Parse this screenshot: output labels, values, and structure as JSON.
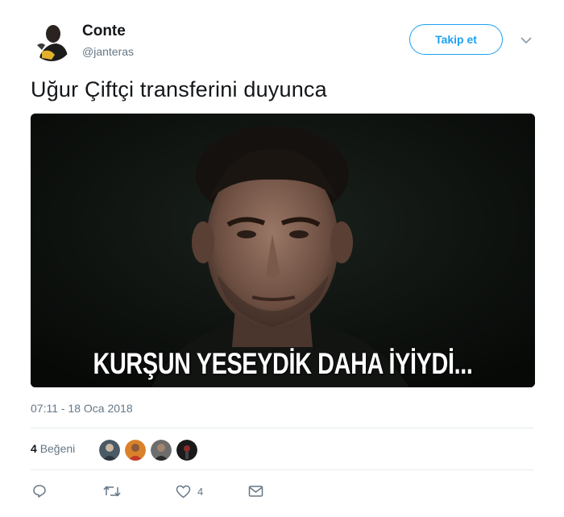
{
  "user": {
    "display_name": "Conte",
    "handle": "@janteras",
    "follow_label": "Takip et",
    "avatar_icon": "user-avatar-icon"
  },
  "tweet": {
    "text": "Uğur Çiftçi transferini duyunca",
    "media_caption": "KURŞUN YESEYDİK DAHA İYİYDİ...",
    "timestamp": "07:11 - 18 Oca 2018"
  },
  "engagement": {
    "like_count": "4",
    "like_label": "Beğeni"
  },
  "actions": {
    "reply_icon": "reply-icon",
    "retweet_icon": "retweet-icon",
    "like_icon": "heart-icon",
    "like_count": "4",
    "dm_icon": "envelope-icon"
  },
  "colors": {
    "accent": "#1da1f2",
    "muted": "#657786",
    "divider": "#e6ecf0"
  }
}
